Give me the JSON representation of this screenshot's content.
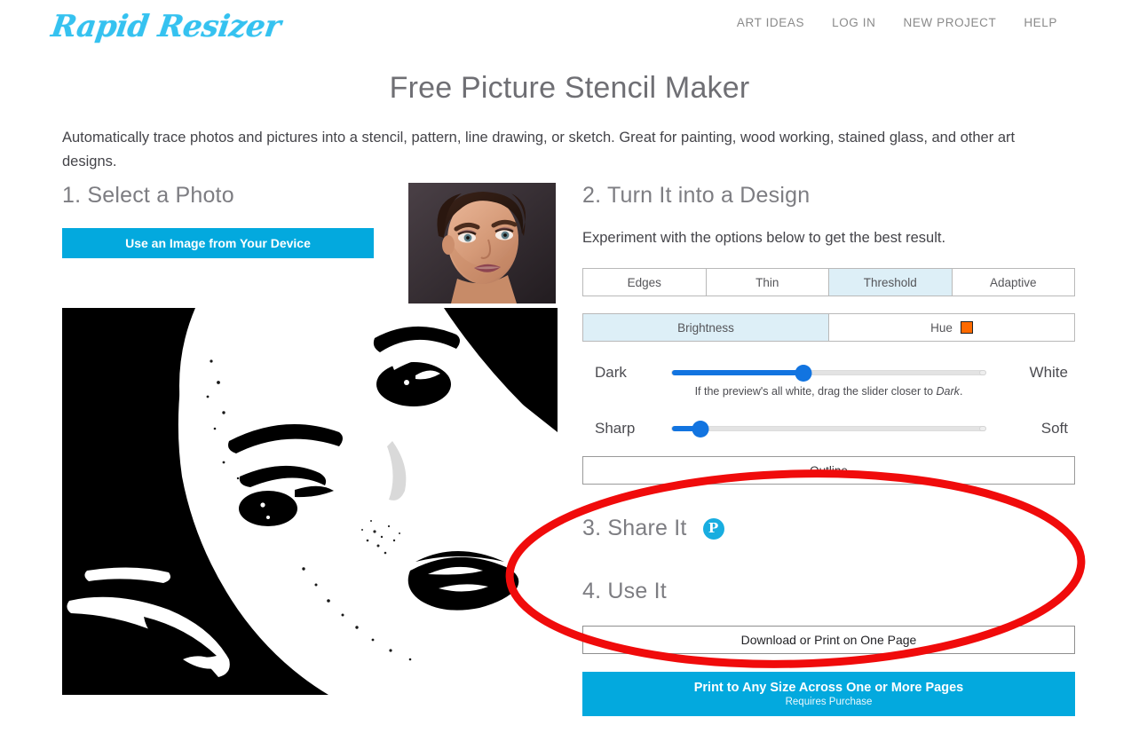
{
  "header": {
    "logo_text": "Rapid Resizer",
    "nav": [
      {
        "label": "ART IDEAS"
      },
      {
        "label": "LOG IN"
      },
      {
        "label": "NEW PROJECT"
      },
      {
        "label": "HELP"
      }
    ]
  },
  "page": {
    "title": "Free Picture Stencil Maker",
    "intro": "Automatically trace photos and pictures into a stencil, pattern, line drawing, or sketch. Great for painting, wood working, stained glass, and other art designs."
  },
  "step1": {
    "heading": "1. Select a Photo",
    "device_button": "Use an Image from Your Device"
  },
  "step2": {
    "heading": "2. Turn It into a Design",
    "subtitle": "Experiment with the options below to get the best result.",
    "mode_tabs": [
      {
        "label": "Edges",
        "selected": false
      },
      {
        "label": "Thin",
        "selected": false
      },
      {
        "label": "Threshold",
        "selected": true
      },
      {
        "label": "Adaptive",
        "selected": false
      }
    ],
    "channel_tabs": [
      {
        "label": "Brightness",
        "selected": true
      },
      {
        "label": "Hue",
        "selected": false,
        "swatch_color": "#FF6A00"
      }
    ],
    "sliders": [
      {
        "left_label": "Dark",
        "right_label": "White",
        "value_percent": 42
      },
      {
        "left_label": "Sharp",
        "right_label": "Soft",
        "value_percent": 9
      }
    ],
    "hint_prefix": "If the preview's all white, drag the slider closer to ",
    "hint_emphasis": "Dark",
    "hint_suffix": ".",
    "outline_button": "Outline"
  },
  "step3": {
    "heading": "3. Share It",
    "pinterest_glyph": "P"
  },
  "step4": {
    "heading": "4. Use It",
    "download_button": "Download or Print on One Page",
    "print_button_line1": "Print to Any Size Across One or More Pages",
    "print_button_line2": "Requires Purchase"
  },
  "colors": {
    "accent_cyan": "#03A9DE",
    "logo_cyan": "#35C2F0",
    "selected_tab": "#ddeff7",
    "slider_blue": "#1274E0",
    "hue_swatch": "#FF6A00",
    "annotation_red": "#F00B0B",
    "pinterest": "#18ADE0"
  },
  "annotation": {
    "shape": "ellipse",
    "color": "#F00B0B"
  }
}
